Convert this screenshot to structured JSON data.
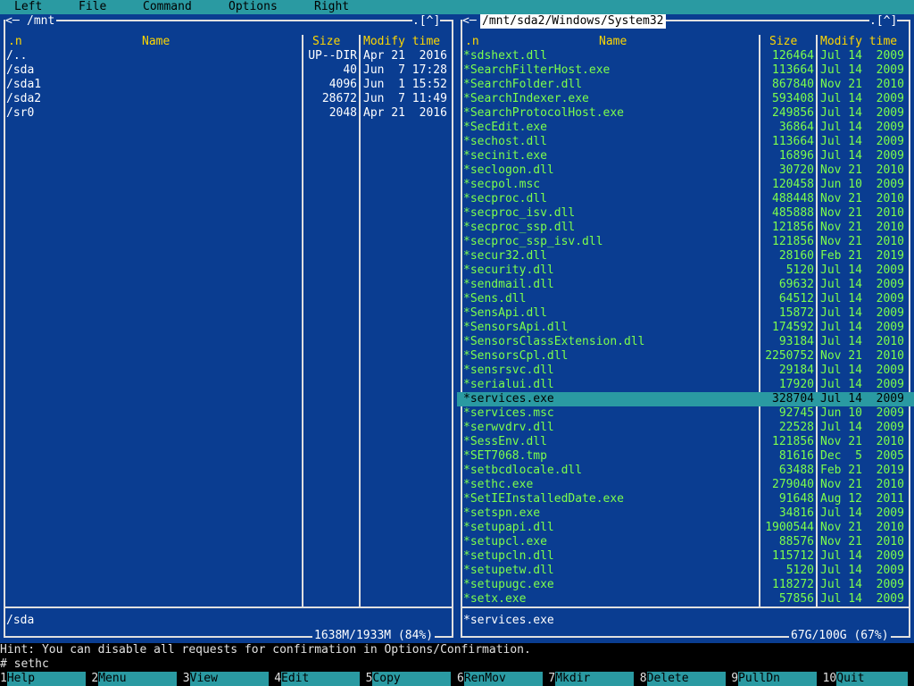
{
  "menubar": {
    "items": [
      "Left",
      "File",
      "Command",
      "Options",
      "Right"
    ]
  },
  "left_panel": {
    "path": "/mnt",
    "corner": ".[^]",
    "col_name_hdr": ".n",
    "col_name": "Name",
    "col_size": "Size",
    "col_time": "Modify time",
    "rows": [
      {
        "name": "/..",
        "size": "UP--DIR",
        "time": "Apr 21  2016"
      },
      {
        "name": "/sda",
        "size": "40",
        "time": "Jun  7 17:28"
      },
      {
        "name": "/sda1",
        "size": "4096",
        "time": "Jun  1 15:52"
      },
      {
        "name": "/sda2",
        "size": "28672",
        "time": "Jun  7 11:49"
      },
      {
        "name": "/sr0",
        "size": "2048",
        "time": "Apr 21  2016"
      }
    ],
    "mini_status": "/sda",
    "usage": "1638M/1933M (84%)"
  },
  "right_panel": {
    "path": "/mnt/sda2/Windows/System32",
    "corner": ".[^]",
    "col_name_hdr": ".n",
    "col_name": "Name",
    "col_size": "Size",
    "col_time": "Modify time",
    "selected_index": 24,
    "rows": [
      {
        "name": "*sdshext.dll",
        "size": "126464",
        "time": "Jul 14  2009"
      },
      {
        "name": "*SearchFilterHost.exe",
        "size": "113664",
        "time": "Jul 14  2009"
      },
      {
        "name": "*SearchFolder.dll",
        "size": "867840",
        "time": "Nov 21  2010"
      },
      {
        "name": "*SearchIndexer.exe",
        "size": "593408",
        "time": "Jul 14  2009"
      },
      {
        "name": "*SearchProtocolHost.exe",
        "size": "249856",
        "time": "Jul 14  2009"
      },
      {
        "name": "*SecEdit.exe",
        "size": "36864",
        "time": "Jul 14  2009"
      },
      {
        "name": "*sechost.dll",
        "size": "113664",
        "time": "Jul 14  2009"
      },
      {
        "name": "*secinit.exe",
        "size": "16896",
        "time": "Jul 14  2009"
      },
      {
        "name": "*seclogon.dll",
        "size": "30720",
        "time": "Nov 21  2010"
      },
      {
        "name": "*secpol.msc",
        "size": "120458",
        "time": "Jun 10  2009"
      },
      {
        "name": "*secproc.dll",
        "size": "488448",
        "time": "Nov 21  2010"
      },
      {
        "name": "*secproc_isv.dll",
        "size": "485888",
        "time": "Nov 21  2010"
      },
      {
        "name": "*secproc_ssp.dll",
        "size": "121856",
        "time": "Nov 21  2010"
      },
      {
        "name": "*secproc_ssp_isv.dll",
        "size": "121856",
        "time": "Nov 21  2010"
      },
      {
        "name": "*secur32.dll",
        "size": "28160",
        "time": "Feb 21  2019"
      },
      {
        "name": "*security.dll",
        "size": "5120",
        "time": "Jul 14  2009"
      },
      {
        "name": "*sendmail.dll",
        "size": "69632",
        "time": "Jul 14  2009"
      },
      {
        "name": "*Sens.dll",
        "size": "64512",
        "time": "Jul 14  2009"
      },
      {
        "name": "*SensApi.dll",
        "size": "15872",
        "time": "Jul 14  2009"
      },
      {
        "name": "*SensorsApi.dll",
        "size": "174592",
        "time": "Jul 14  2009"
      },
      {
        "name": "*SensorsClassExtension.dll",
        "size": "93184",
        "time": "Jul 14  2010"
      },
      {
        "name": "*SensorsCpl.dll",
        "size": "2250752",
        "time": "Nov 21  2010"
      },
      {
        "name": "*sensrsvc.dll",
        "size": "29184",
        "time": "Jul 14  2009"
      },
      {
        "name": "*serialui.dll",
        "size": "17920",
        "time": "Jul 14  2009"
      },
      {
        "name": "*services.exe",
        "size": "328704",
        "time": "Jul 14  2009"
      },
      {
        "name": "*services.msc",
        "size": "92745",
        "time": "Jun 10  2009"
      },
      {
        "name": "*serwvdrv.dll",
        "size": "22528",
        "time": "Jul 14  2009"
      },
      {
        "name": "*SessEnv.dll",
        "size": "121856",
        "time": "Nov 21  2010"
      },
      {
        "name": "*SET7068.tmp",
        "size": "81616",
        "time": "Dec  5  2005"
      },
      {
        "name": "*setbcdlocale.dll",
        "size": "63488",
        "time": "Feb 21  2019"
      },
      {
        "name": "*sethc.exe",
        "size": "279040",
        "time": "Nov 21  2010"
      },
      {
        "name": "*SetIEInstalledDate.exe",
        "size": "91648",
        "time": "Aug 12  2011"
      },
      {
        "name": "*setspn.exe",
        "size": "34816",
        "time": "Jul 14  2009"
      },
      {
        "name": "*setupapi.dll",
        "size": "1900544",
        "time": "Nov 21  2010"
      },
      {
        "name": "*setupcl.exe",
        "size": "88576",
        "time": "Nov 21  2010"
      },
      {
        "name": "*setupcln.dll",
        "size": "115712",
        "time": "Jul 14  2009"
      },
      {
        "name": "*setupetw.dll",
        "size": "5120",
        "time": "Jul 14  2009"
      },
      {
        "name": "*setupugc.exe",
        "size": "118272",
        "time": "Jul 14  2009"
      },
      {
        "name": "*setx.exe",
        "size": "57856",
        "time": "Jul 14  2009"
      }
    ],
    "mini_status": "*services.exe",
    "usage": "67G/100G (67%)"
  },
  "hint": "Hint: You can disable all requests for confirmation in Options/Confirmation.",
  "command_line": "# sethc",
  "fkeys": [
    {
      "num": "1",
      "label": "Help"
    },
    {
      "num": "2",
      "label": "Menu"
    },
    {
      "num": "3",
      "label": "View"
    },
    {
      "num": "4",
      "label": "Edit"
    },
    {
      "num": "5",
      "label": "Copy"
    },
    {
      "num": "6",
      "label": "RenMov"
    },
    {
      "num": "7",
      "label": "Mkdir"
    },
    {
      "num": "8",
      "label": "Delete"
    },
    {
      "num": "9",
      "label": "PullDn"
    },
    {
      "num": "10",
      "label": "Quit"
    }
  ],
  "colors": {
    "menubar_bg": "#2a9aa2",
    "panel_bg": "#0a3d91",
    "header_fg": "#ffd700",
    "executable_fg": "#7cff4c",
    "selection_bg": "#2a9aa2"
  }
}
